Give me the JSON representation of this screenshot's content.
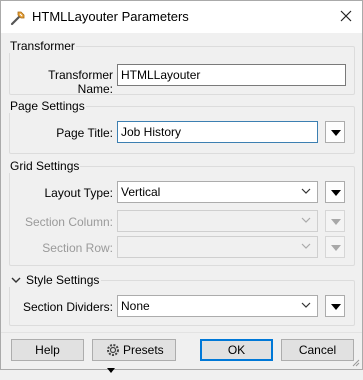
{
  "window": {
    "title": "HTMLLayouter Parameters"
  },
  "transformer": {
    "group_title": "Transformer",
    "name_label": "Transformer Name:",
    "name_value": "HTMLLayouter"
  },
  "page_settings": {
    "group_title": "Page Settings",
    "title_label": "Page Title:",
    "title_value": "Job History"
  },
  "grid_settings": {
    "group_title": "Grid Settings",
    "layout_type_label": "Layout Type:",
    "layout_type_value": "Vertical",
    "section_column_label": "Section Column:",
    "section_column_value": "",
    "section_row_label": "Section Row:",
    "section_row_value": ""
  },
  "style_settings": {
    "group_title": "Style Settings",
    "section_dividers_label": "Section Dividers:",
    "section_dividers_value": "None"
  },
  "buttons": {
    "help": "Help",
    "presets": "Presets",
    "ok": "OK",
    "cancel": "Cancel"
  }
}
